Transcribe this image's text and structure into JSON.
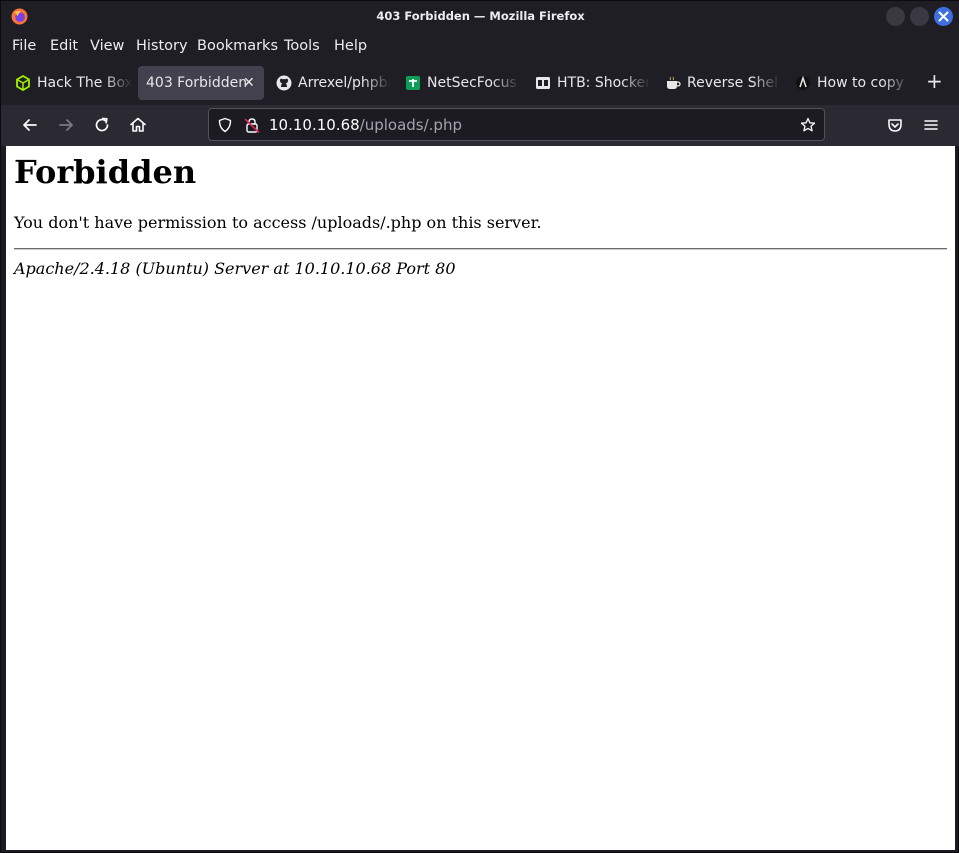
{
  "window": {
    "title": "403 Forbidden — Mozilla Firefox"
  },
  "menu": [
    "File",
    "Edit",
    "View",
    "History",
    "Bookmarks",
    "Tools",
    "Help"
  ],
  "tabs": [
    {
      "label": "Hack The Box",
      "icon": "hackthebox-icon",
      "active": false
    },
    {
      "label": "403 Forbidden",
      "icon": "",
      "active": true
    },
    {
      "label": "Arrexel/phpbash",
      "icon": "github-icon",
      "active": false
    },
    {
      "label": "NetSecFocus",
      "icon": "sheets-icon",
      "active": false
    },
    {
      "label": "HTB: Shocker",
      "icon": "htb-writeup-icon",
      "active": false
    },
    {
      "label": "Reverse Shell",
      "icon": "coffee-icon",
      "active": false
    },
    {
      "label": "How to copy a",
      "icon": "site-icon",
      "active": false
    }
  ],
  "address": {
    "host": "10.10.10.68",
    "path": "/uploads/.php"
  },
  "page": {
    "heading": "Forbidden",
    "message": "You don't have permission to access /uploads/.php on this server.",
    "server": "Apache/2.4.18 (Ubuntu) Server at 10.10.10.68 Port 80"
  },
  "colors": {
    "chrome": "#1f1e25",
    "toolbar": "#2b2a33",
    "close_button": "#3d6fe0",
    "active_tab": "#42414d"
  }
}
